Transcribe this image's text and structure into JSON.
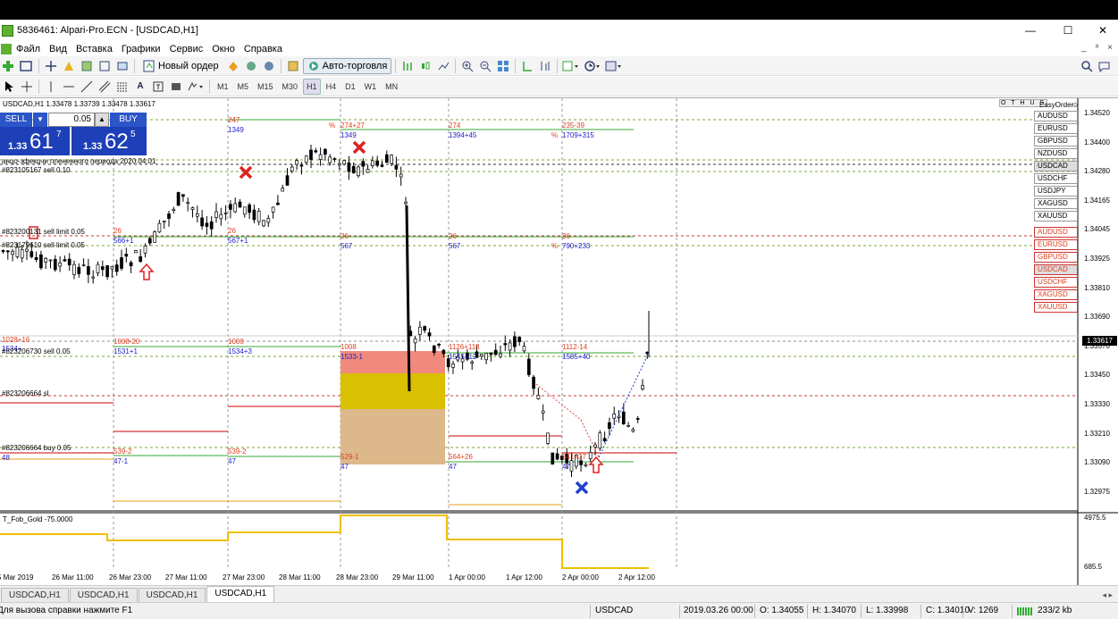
{
  "window": {
    "title": "5836461: Alpari-Pro.ECN - [USDCAD,H1]",
    "minimize": "—",
    "maximize": "☐",
    "close": "✕",
    "mdi_min": "_",
    "mdi_restore": "ᵊ",
    "mdi_close": "×"
  },
  "menu": [
    "Файл",
    "Вид",
    "Вставка",
    "Графики",
    "Сервис",
    "Окно",
    "Справка"
  ],
  "toolbar": {
    "new_order": "Новый ордер",
    "auto_trading": "Авто-торговля"
  },
  "toolbar2": {
    "text_tool": "A",
    "timeframes": [
      "M1",
      "M5",
      "M15",
      "M30",
      "H1",
      "H4",
      "D1",
      "W1",
      "MN"
    ],
    "active_timeframe": "H1"
  },
  "chart": {
    "header": "USDCAD,H1  1.33478 1.33739 1.33478 1.33617",
    "indicator_label": "T_Fob_Gold -75.0000",
    "indicator_level": "4975.5",
    "indicator_min": "685.5",
    "ea_name": "EasyOrder",
    "ea_buttons": "O T H U S",
    "current_price": "1.33617",
    "price_ticks": [
      "1.34520",
      "1.34400",
      "1.34280",
      "1.34165",
      "1.34045",
      "1.33925",
      "1.33810",
      "1.33690",
      "1.33570",
      "1.33450",
      "1.33330",
      "1.33210",
      "1.33090",
      "1.32975"
    ],
    "time_ticks": [
      "5 Mar 2019",
      "26 Mar 11:00",
      "26 Mar 23:00",
      "27 Mar 11:00",
      "27 Mar 23:00",
      "28 Mar 11:00",
      "28 Mar 23:00",
      "29 Mar 11:00",
      "1 Apr 00:00",
      "1 Apr 12:00",
      "2 Apr 00:00",
      "2 Apr 12:00"
    ],
    "order_labels": {
      "end_of_period": "анцо-зфекцчи плененного периода 2020.04.01",
      "sell_010": "#823105167 sell 0.10",
      "sell_limit_a": "#823200131 sell limit 0.05",
      "sell_limit_b": "#823179610 sell limit 0.05",
      "sell_005": "#823206730 sell 0.05",
      "sl": "#823206664 sl",
      "buy_005": "#823206664 buy 0.05",
      "v1028": "1028+16",
      "v1534": "1534+"
    },
    "period_labels": [
      {
        "top": "247",
        "bottom": "1349"
      },
      {
        "top": "274+27",
        "bottom": "1349"
      },
      {
        "top": "274",
        "bottom": "1394+45"
      },
      {
        "top": "235-39",
        "bottom": "1709+315"
      }
    ],
    "mid_labels": [
      {
        "top": "26",
        "bottom": "566+1"
      },
      {
        "top": "26",
        "bottom": "567+1"
      },
      {
        "top": "26",
        "bottom": "567"
      },
      {
        "top": "26",
        "bottom": "567"
      },
      {
        "top": "26",
        "bottom": "790+233"
      }
    ],
    "low_labels": [
      {
        "top": "1008-20",
        "bottom": "1531+1"
      },
      {
        "top": "1008",
        "bottom": "1534+3"
      },
      {
        "top": "1008",
        "bottom": "1533-1"
      },
      {
        "top": "1126+118",
        "bottom": "1545+12"
      },
      {
        "top": "1112-14",
        "bottom": "1585+40"
      }
    ],
    "bottom_labels": [
      {
        "top": "539-2",
        "bottom": "47-1"
      },
      {
        "top": "539-2",
        "bottom": "47"
      },
      {
        "top": "529-1",
        "bottom": "47"
      },
      {
        "top": "564+26",
        "bottom": "47"
      },
      {
        "top": "541+37",
        "bottom": "47"
      }
    ],
    "pct": "%",
    "left_edge_48": "48",
    "symbols_a": [
      "AUDUSD",
      "EURUSD",
      "GBPUSD",
      "NZDUSD",
      "USDCAD",
      "USDCHF",
      "USDJPY",
      "XAGUSD",
      "XAUUSD"
    ],
    "symbols_b": [
      "AUDUSD",
      "EURUSD",
      "GBPUSD",
      "USDCAD",
      "USDCHF",
      "XAGUSD",
      "XAUUSD"
    ],
    "selected_symbol": "USDCAD"
  },
  "trade_panel": {
    "sell_label": "SELL",
    "buy_label": "BUY",
    "lot": "0.05",
    "sell_prefix": "1.33",
    "sell_big": "61",
    "sell_sup": "7",
    "buy_prefix": "1.33",
    "buy_big": "62",
    "buy_sup": "5"
  },
  "tabs": [
    "USDCAD,H1",
    "USDCAD,H1",
    "USDCAD,H1",
    "USDCAD,H1"
  ],
  "status": {
    "help": "Для вызова справки нажмите F1",
    "symbol": "USDCAD",
    "datetime": "2019.03.26 00:00",
    "open": "O: 1.34055",
    "high": "H: 1.34070",
    "low": "L: 1.33998",
    "close": "C: 1.34010",
    "volume": "V: 1269",
    "traffic": "233/2 kb"
  },
  "colors": {
    "sell_blue": "#1d3fb8",
    "red_marker": "#e02020",
    "blue_marker": "#2040d0",
    "gold_line": "#f0c000",
    "salmon_zone": "#f08a7c",
    "yellow_zone": "#d9c000",
    "tan_zone": "#ddb88a"
  }
}
